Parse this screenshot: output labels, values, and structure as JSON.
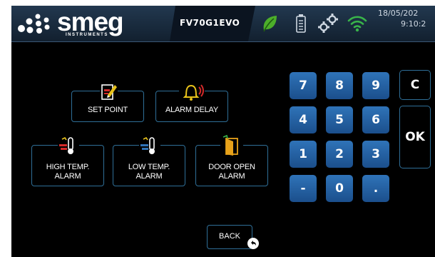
{
  "brand": {
    "name": "smeg",
    "subtitle": "INSTRUMENTS"
  },
  "header": {
    "model": "FV70G1EVO",
    "date": "18/05/202",
    "time": "9:10:2",
    "icons": [
      "leaf-icon",
      "battery-icon",
      "settings-gears-icon",
      "wifi-icon"
    ]
  },
  "menu": {
    "set_point": "SET POINT",
    "alarm_delay": "ALARM DELAY",
    "high_temp": [
      "HIGH TEMP.",
      "ALARM"
    ],
    "low_temp": [
      "LOW TEMP.",
      "ALARM"
    ],
    "door_open": [
      "DOOR OPEN",
      "ALARM"
    ]
  },
  "keypad": {
    "rows": [
      [
        "7",
        "8",
        "9"
      ],
      [
        "4",
        "5",
        "6"
      ],
      [
        "1",
        "2",
        "3"
      ],
      [
        "-",
        "0",
        "."
      ]
    ],
    "clear": "C",
    "ok": "OK"
  },
  "back": {
    "label": "BACK"
  },
  "colors": {
    "accent": "#2f73b8",
    "border": "#2f6f98",
    "leaf": "#4caf2a",
    "wifi": "#39b54a",
    "alarm_yellow": "#e8c21a",
    "alarm_red": "#d42a2a"
  }
}
